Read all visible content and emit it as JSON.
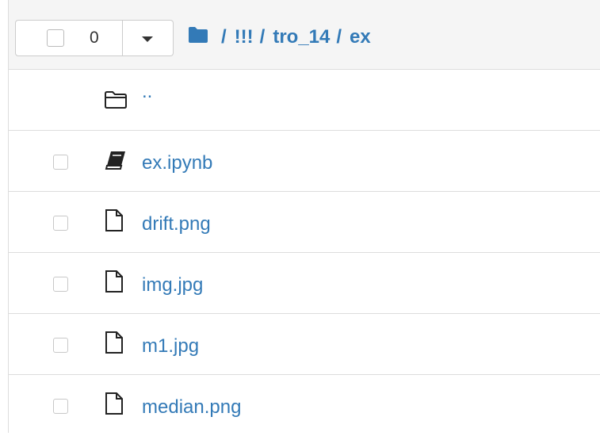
{
  "toolbar": {
    "selected_count": "0"
  },
  "breadcrumb": {
    "items": [
      "!!!",
      "tro_14",
      "ex"
    ],
    "separator": "/"
  },
  "parent_dir": {
    "label": ".."
  },
  "files": [
    {
      "name": "ex.ipynb",
      "icon": "notebook-icon"
    },
    {
      "name": "drift.png",
      "icon": "file-icon"
    },
    {
      "name": "img.jpg",
      "icon": "file-icon"
    },
    {
      "name": "m1.jpg",
      "icon": "file-icon"
    },
    {
      "name": "median.png",
      "icon": "file-icon"
    }
  ],
  "colors": {
    "link": "#337ab7",
    "header_bg": "#f5f5f5",
    "border": "#dddddd"
  }
}
